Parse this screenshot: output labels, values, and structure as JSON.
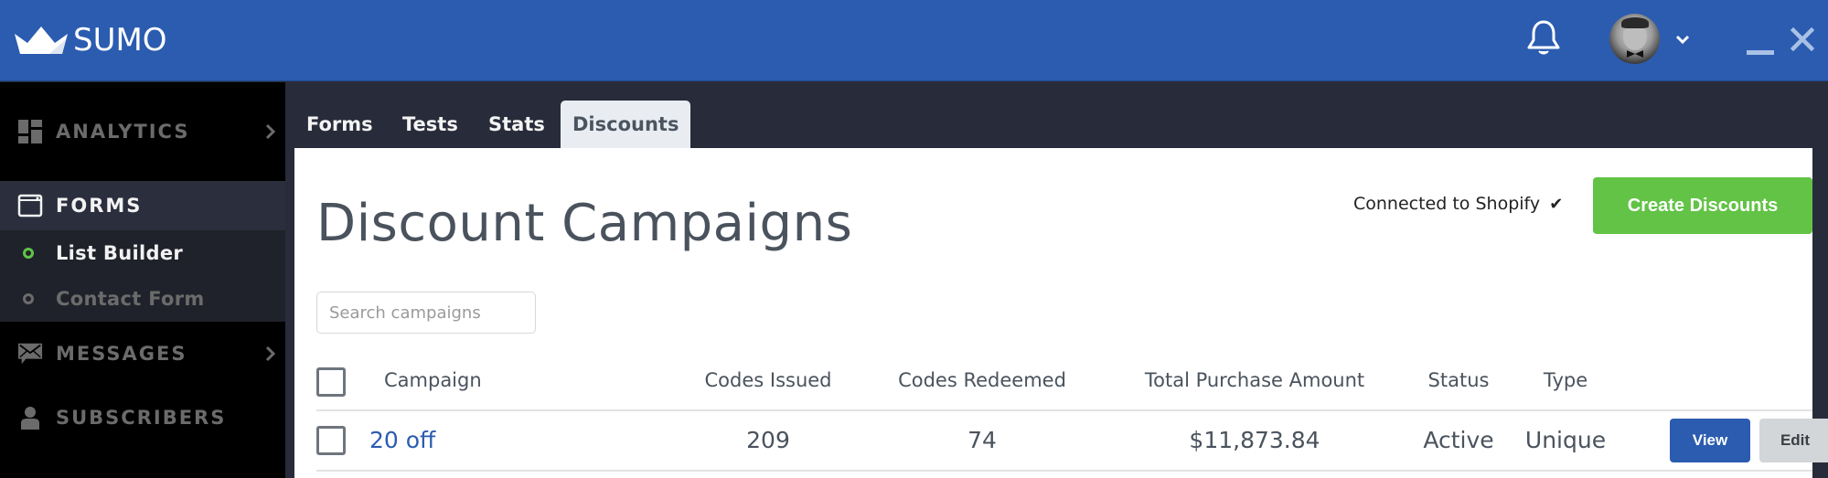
{
  "header": {
    "brand": "SUMO",
    "icons": {
      "logo": "crown-icon",
      "notifications": "bell-icon",
      "avatar": "user-avatar",
      "avatar_menu": "chevron-down-icon",
      "minimize": "minimize-icon",
      "close": "close-icon"
    },
    "colors": {
      "bar": "#2b5cb0"
    }
  },
  "sidebar": {
    "items": [
      {
        "label": "ANALYTICS",
        "icon": "dashboard-grid-icon",
        "has_submenu": true
      },
      {
        "label": "FORMS",
        "icon": "window-icon",
        "active": true
      },
      {
        "label": "List Builder",
        "icon": "dot-icon",
        "sub": true,
        "active": true
      },
      {
        "label": "Contact Form",
        "icon": "dot-icon",
        "sub": true
      },
      {
        "label": "MESSAGES",
        "icon": "envelope-icon",
        "has_submenu": true
      },
      {
        "label": "SUBSCRIBERS",
        "icon": "user-icon"
      }
    ]
  },
  "tabs": [
    {
      "label": "Forms"
    },
    {
      "label": "Tests"
    },
    {
      "label": "Stats"
    },
    {
      "label": "Discounts",
      "active": true
    }
  ],
  "main": {
    "title": "Discount Campaigns",
    "shopify_status": "Connected to Shopify",
    "shopify_check": "✔",
    "create_button": "Create Discounts",
    "search": {
      "placeholder": "Search campaigns",
      "value": ""
    },
    "colors": {
      "primary": "#2b5cb0",
      "success": "#62c346"
    }
  },
  "table": {
    "columns": [
      "Campaign",
      "Codes Issued",
      "Codes Redeemed",
      "Total Purchase Amount",
      "Status",
      "Type"
    ],
    "rows": [
      {
        "campaign": "20 off",
        "codes_issued": "209",
        "codes_redeemed": "74",
        "total_purchase_amount": "$11,873.84",
        "status": "Active",
        "type": "Unique",
        "actions": {
          "view": "View",
          "edit": "Edit"
        }
      }
    ]
  }
}
